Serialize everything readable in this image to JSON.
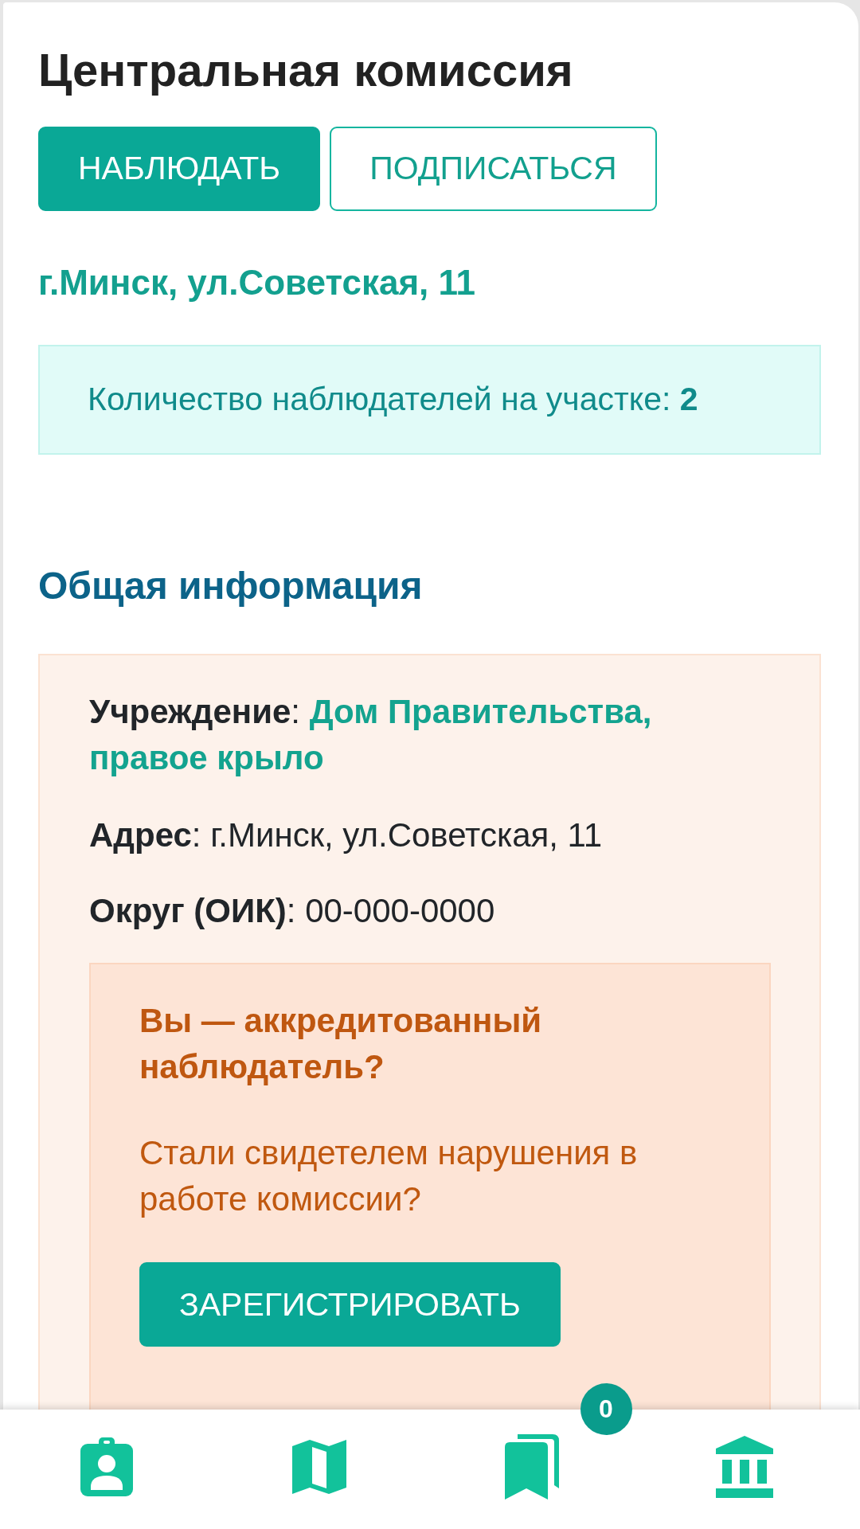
{
  "page": {
    "title": "Центральная комиссия",
    "actions": [
      {
        "label": "НАБЛЮДАТЬ",
        "kind": "primary"
      },
      {
        "label": "ПОДПИСАТЬСЯ",
        "kind": "outline"
      }
    ],
    "address": "г.Минск, ул.Советская, 11",
    "observers_notice": "Количество наблюдателей на участке: **2**"
  },
  "general_info": {
    "heading": "Общая информация",
    "fields": [
      {
        "label": "**Учреждение**:",
        "value": "Дом Правительства, правое крыло",
        "kind": "link"
      },
      {
        "label": "**Адрес**:",
        "value": "г.Минск, ул.Советская, 11",
        "kind": "plain"
      },
      {
        "label": "**Округ (ОИК)**:",
        "value": "00-000-0000",
        "kind": "plain"
      }
    ],
    "callout": {
      "heading": "Вы — аккредитованный наблюдатель?",
      "text": "Стали свидетелем нарушения в работе комиссии?",
      "button": "ЗАРЕГИСТРИРОВАТЬ"
    }
  },
  "bottom_nav": {
    "badge": "0"
  }
}
